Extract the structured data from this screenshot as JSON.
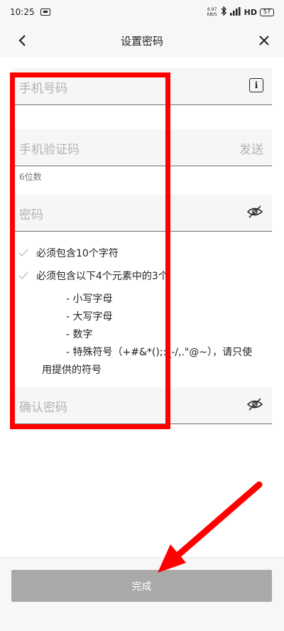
{
  "status_bar": {
    "time": "10:25",
    "net_speed_value": "6.97",
    "net_speed_unit": "KB/S",
    "signal_text": "HD",
    "battery_level": "57"
  },
  "nav": {
    "title": "设置密码"
  },
  "form": {
    "phone_label": "手机号码",
    "code_label": "手机验证码",
    "send_label": "发送",
    "code_hint": "6位数",
    "password_label": "密码",
    "confirm_label": "确认密码"
  },
  "rules": {
    "rule1": "必须包含10个字符",
    "rule2": "必须包含以下4个元素中的3个",
    "items": [
      "- 小写字母",
      "- 大写字母",
      "- 数字",
      "- 特殊符号（+#&*();:_-/,.\"@~），请只使",
      "用提供的符号"
    ]
  },
  "footer": {
    "done_label": "完成"
  },
  "colors": {
    "annotation_red": "#ff0000",
    "disabled_button": "#a9a9a9"
  }
}
